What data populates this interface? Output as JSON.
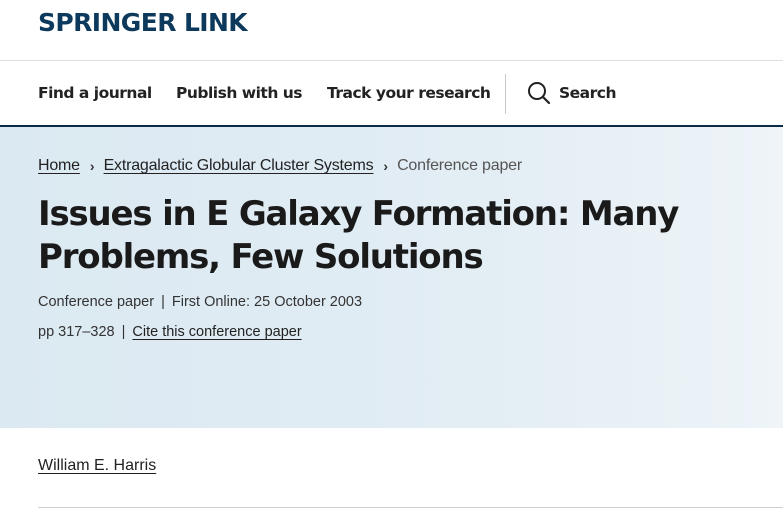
{
  "brand": {
    "logo_text": "SPRINGER LINK",
    "color": "#0d3a5c"
  },
  "nav": {
    "items": [
      {
        "label": "Find a journal"
      },
      {
        "label": "Publish with us"
      },
      {
        "label": "Track your research"
      }
    ],
    "search_label": "Search",
    "search_icon": "search-icon"
  },
  "breadcrumb": {
    "home": "Home",
    "book": "Extragalactic Globular Cluster Systems",
    "current": "Conference paper",
    "separator_icon": "chevron-right-icon"
  },
  "article": {
    "title": "Issues in E Galaxy Formation: Many Problems, Few Solutions",
    "type": "Conference paper",
    "first_online": "First Online: 25 October 2003",
    "pages": "pp 317–328",
    "cite_label": "Cite this conference paper"
  },
  "author": {
    "name": "William E. Harris"
  },
  "colors": {
    "hero_bg": "#dbe9f2",
    "nav_border": "#0d2b44"
  }
}
